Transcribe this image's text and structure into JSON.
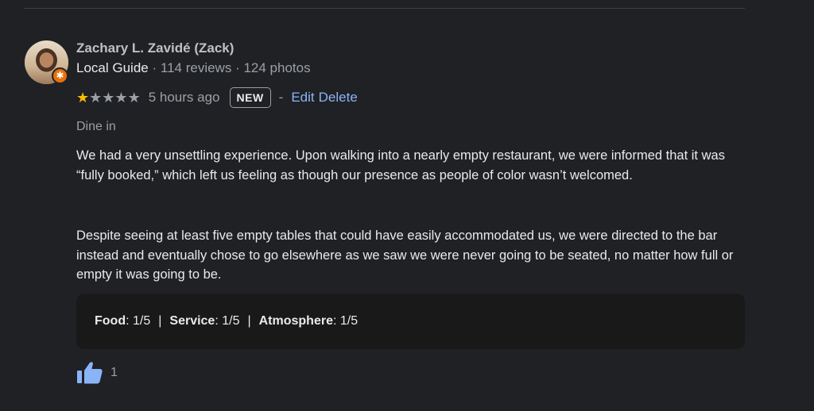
{
  "review": {
    "author": "Zachary L. Zavidé (Zack)",
    "local_guide": "Local Guide",
    "reviews_count": "114 reviews",
    "photos_count": "124 photos",
    "meta_sep": "·",
    "rating": 1,
    "rating_max": 5,
    "time": "5 hours ago",
    "badge": "NEW",
    "action_sep": "-",
    "edit_label": "Edit",
    "delete_label": "Delete",
    "dine": "Dine in",
    "paragraphs": [
      "We had a very unsettling experience. Upon walking into a nearly empty restaurant, we were informed that it was “fully booked,” which left us feeling as though our presence as people of color wasn’t welcomed.",
      "Despite seeing at least five empty tables that could have easily accommodated us, we were directed to the bar instead and eventually chose to go elsewhere as we saw we were never going to be seated, no matter how full or empty it was going to be."
    ],
    "subratings": [
      {
        "label": "Food",
        "value": "1/5"
      },
      {
        "label": "Service",
        "value": "1/5"
      },
      {
        "label": "Atmosphere",
        "value": "1/5"
      }
    ],
    "subrating_sep": "|",
    "likes": "1"
  },
  "colors": {
    "background": "#202124",
    "link": "#8ab4f8",
    "star": "#fbbc04",
    "badge": "#e8710a",
    "thumb": "#8ab4f8"
  },
  "icons": {
    "avatar": "user-avatar",
    "guide_badge": "star-icon",
    "like": "thumbs-up-icon"
  }
}
